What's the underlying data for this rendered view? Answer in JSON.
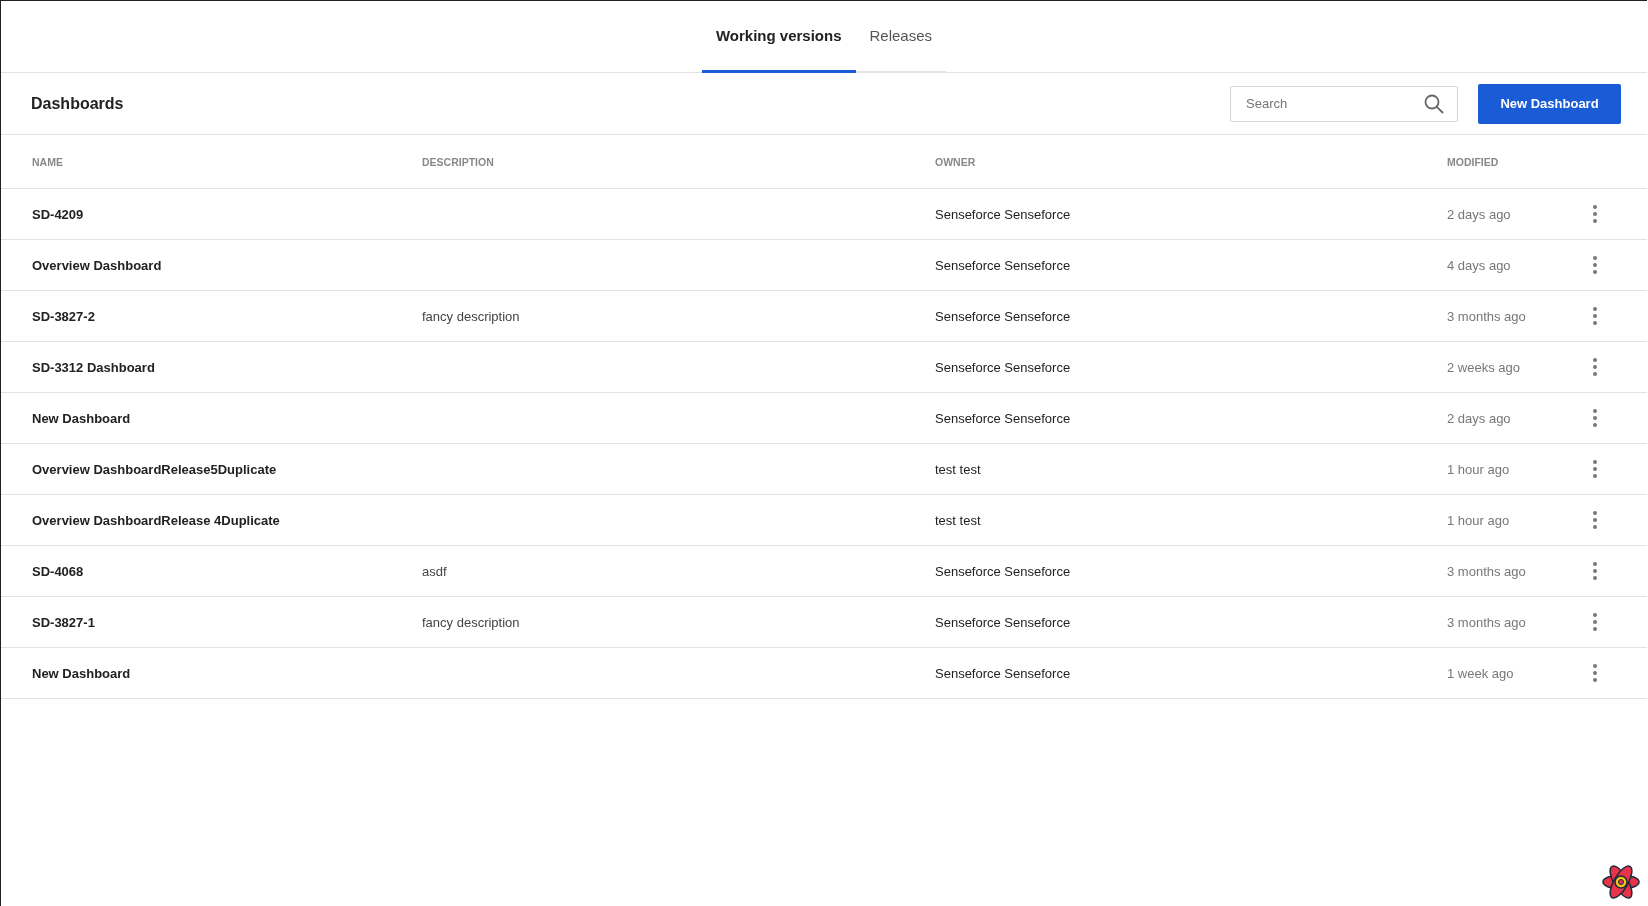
{
  "tabs": [
    {
      "label": "Working versions",
      "selected": true
    },
    {
      "label": "Releases",
      "selected": false
    }
  ],
  "toolbar": {
    "title": "Dashboards",
    "search": {
      "placeholder": "Search"
    },
    "new_button": "New Dashboard"
  },
  "table": {
    "columns": [
      "NAME",
      "DESCRIPTION",
      "OWNER",
      "MODIFIED"
    ],
    "rows": [
      {
        "name": "SD-4209",
        "owner": "Senseforce Senseforce",
        "modified": "2 days ago"
      },
      {
        "name": "Overview Dashboard",
        "owner": "Senseforce Senseforce",
        "modified": "4 days ago"
      },
      {
        "name": "SD-3827-2",
        "description": "fancy description",
        "owner": "Senseforce Senseforce",
        "modified": "3 months ago"
      },
      {
        "name": "SD-3312 Dashboard",
        "owner": "Senseforce Senseforce",
        "modified": "2 weeks ago"
      },
      {
        "name": "New Dashboard",
        "owner": "Senseforce Senseforce",
        "modified": "2 days ago"
      },
      {
        "name": "Overview DashboardRelease5Duplicate",
        "owner": "test test",
        "modified": "1 hour ago"
      },
      {
        "name": "Overview DashboardRelease 4Duplicate",
        "owner": "test test",
        "modified": "1 hour ago"
      },
      {
        "name": "SD-4068",
        "description": "asdf",
        "owner": "Senseforce Senseforce",
        "modified": "3 months ago"
      },
      {
        "name": "SD-3827-1",
        "description": "fancy description",
        "owner": "Senseforce Senseforce",
        "modified": "3 months ago"
      },
      {
        "name": "New Dashboard",
        "owner": "Senseforce Senseforce",
        "modified": "1 week ago"
      }
    ]
  }
}
